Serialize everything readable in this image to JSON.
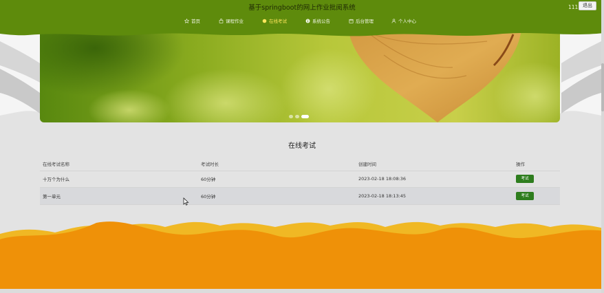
{
  "header": {
    "site_title": "基于springboot的网上作业批阅系统",
    "user_name": "111",
    "logout_label": "退出"
  },
  "nav": {
    "items": [
      {
        "label": "首页",
        "icon": "star-icon"
      },
      {
        "label": "课程作业",
        "icon": "bag-icon"
      },
      {
        "label": "在线考试",
        "icon": "circle-icon",
        "active": true
      },
      {
        "label": "系统公告",
        "icon": "info-icon"
      },
      {
        "label": "后台管理",
        "icon": "calendar-icon"
      },
      {
        "label": "个人中心",
        "icon": "user-icon"
      }
    ]
  },
  "banner": {
    "dots_total": 3,
    "active_index": 2
  },
  "exams": {
    "title": "在线考试",
    "columns": [
      "在线考试名称",
      "考试时长",
      "创建时间",
      "操作"
    ],
    "rows": [
      {
        "name": "十万个为什么",
        "duration": "60分钟",
        "created": "2023-02-18 18:08:36",
        "action": "考试"
      },
      {
        "name": "第一单元",
        "duration": "60分钟",
        "created": "2023-02-18 18:13:45",
        "action": "考试"
      }
    ]
  },
  "colors": {
    "header_green": "#5e8b0c",
    "nav_active": "#ffe65c",
    "exam_button": "#2e7d1e",
    "footer_orange": "#ef9108",
    "footer_yellow": "#f0b824"
  }
}
